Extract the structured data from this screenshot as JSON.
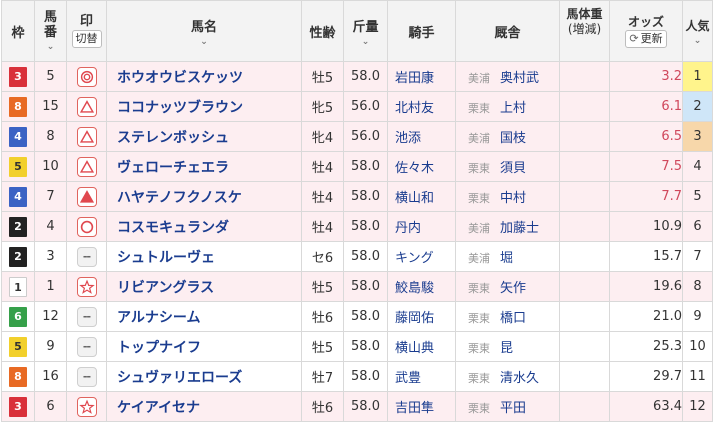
{
  "header": {
    "waku": "枠",
    "umaban_1": "馬",
    "umaban_2": "番",
    "mark": "印",
    "mark_toggle": "切替",
    "name": "馬名",
    "sex_age": "性齢",
    "weight_1": "斤",
    "weight_2": "量",
    "jockey": "騎手",
    "trainer": "厩舎",
    "body_weight": "馬体重",
    "body_change": "(増減)",
    "odds": "オッズ",
    "update": "更新",
    "popularity": "人気"
  },
  "colors": {
    "frame_bg": [
      "#ffffff",
      "#ffffff",
      "#222222",
      "#d9303a",
      "#3b63c4",
      "#f2d02c",
      "#36a04a",
      "#f07a97",
      "#e86a24"
    ],
    "pink_row": "#fdeef1",
    "link_blue": "#1a3c8f",
    "odds_red": "#d0485c",
    "pop1": "#fff48c",
    "pop2": "#cfe6f8",
    "pop3": "#f7d7aa"
  },
  "rows": [
    {
      "frame": "3",
      "num": "5",
      "mark": "double-circle",
      "name": "ホウオウビスケッツ",
      "sexage": "牡5",
      "weight": "58.0",
      "jockey": "岩田康",
      "region": "美浦",
      "trainer": "奥村武",
      "odds": "3.2",
      "pop": "1",
      "pink": true
    },
    {
      "frame": "8",
      "num": "15",
      "mark": "triangle-outline",
      "name": "ココナッツブラウン",
      "sexage": "牝5",
      "weight": "56.0",
      "jockey": "北村友",
      "region": "栗東",
      "trainer": "上村",
      "odds": "6.1",
      "pop": "2",
      "pink": true
    },
    {
      "frame": "4",
      "num": "8",
      "mark": "triangle-outline",
      "name": "ステレンボッシュ",
      "sexage": "牝4",
      "weight": "56.0",
      "jockey": "池添",
      "region": "美浦",
      "trainer": "国枝",
      "odds": "6.5",
      "pop": "3",
      "pink": true
    },
    {
      "frame": "5",
      "num": "10",
      "mark": "triangle-outline",
      "name": "ヴェローチェエラ",
      "sexage": "牡4",
      "weight": "58.0",
      "jockey": "佐々木",
      "region": "栗東",
      "trainer": "須貝",
      "odds": "7.5",
      "pop": "4",
      "pink": true
    },
    {
      "frame": "4",
      "num": "7",
      "mark": "triangle-filled",
      "name": "ハヤテノフクノスケ",
      "sexage": "牡4",
      "weight": "58.0",
      "jockey": "横山和",
      "region": "栗東",
      "trainer": "中村",
      "odds": "7.7",
      "pop": "5",
      "pink": true
    },
    {
      "frame": "2",
      "num": "4",
      "mark": "circle",
      "name": "コスモキュランダ",
      "sexage": "牡4",
      "weight": "58.0",
      "jockey": "丹内",
      "region": "美浦",
      "trainer": "加藤士",
      "odds": "10.9",
      "pop": "6",
      "pink": true
    },
    {
      "frame": "2",
      "num": "3",
      "mark": "none",
      "name": "シュトルーヴェ",
      "sexage": "セ6",
      "weight": "58.0",
      "jockey": "キング",
      "region": "美浦",
      "trainer": "堀",
      "odds": "15.7",
      "pop": "7",
      "pink": false
    },
    {
      "frame": "1",
      "num": "1",
      "mark": "star",
      "name": "リビアングラス",
      "sexage": "牡5",
      "weight": "58.0",
      "jockey": "鮫島駿",
      "region": "栗東",
      "trainer": "矢作",
      "odds": "19.6",
      "pop": "8",
      "pink": true
    },
    {
      "frame": "6",
      "num": "12",
      "mark": "none",
      "name": "アルナシーム",
      "sexage": "牡6",
      "weight": "58.0",
      "jockey": "藤岡佑",
      "region": "栗東",
      "trainer": "橋口",
      "odds": "21.0",
      "pop": "9",
      "pink": false
    },
    {
      "frame": "5",
      "num": "9",
      "mark": "none",
      "name": "トップナイフ",
      "sexage": "牡5",
      "weight": "58.0",
      "jockey": "横山典",
      "region": "栗東",
      "trainer": "昆",
      "odds": "25.3",
      "pop": "10",
      "pink": false
    },
    {
      "frame": "8",
      "num": "16",
      "mark": "none",
      "name": "シュヴァリエローズ",
      "sexage": "牡7",
      "weight": "58.0",
      "jockey": "武豊",
      "region": "栗東",
      "trainer": "清水久",
      "odds": "29.7",
      "pop": "11",
      "pink": false
    },
    {
      "frame": "3",
      "num": "6",
      "mark": "star",
      "name": "ケイアイセナ",
      "sexage": "牡6",
      "weight": "58.0",
      "jockey": "吉田隼",
      "region": "栗東",
      "trainer": "平田",
      "odds": "63.4",
      "pop": "12",
      "pink": true
    }
  ]
}
